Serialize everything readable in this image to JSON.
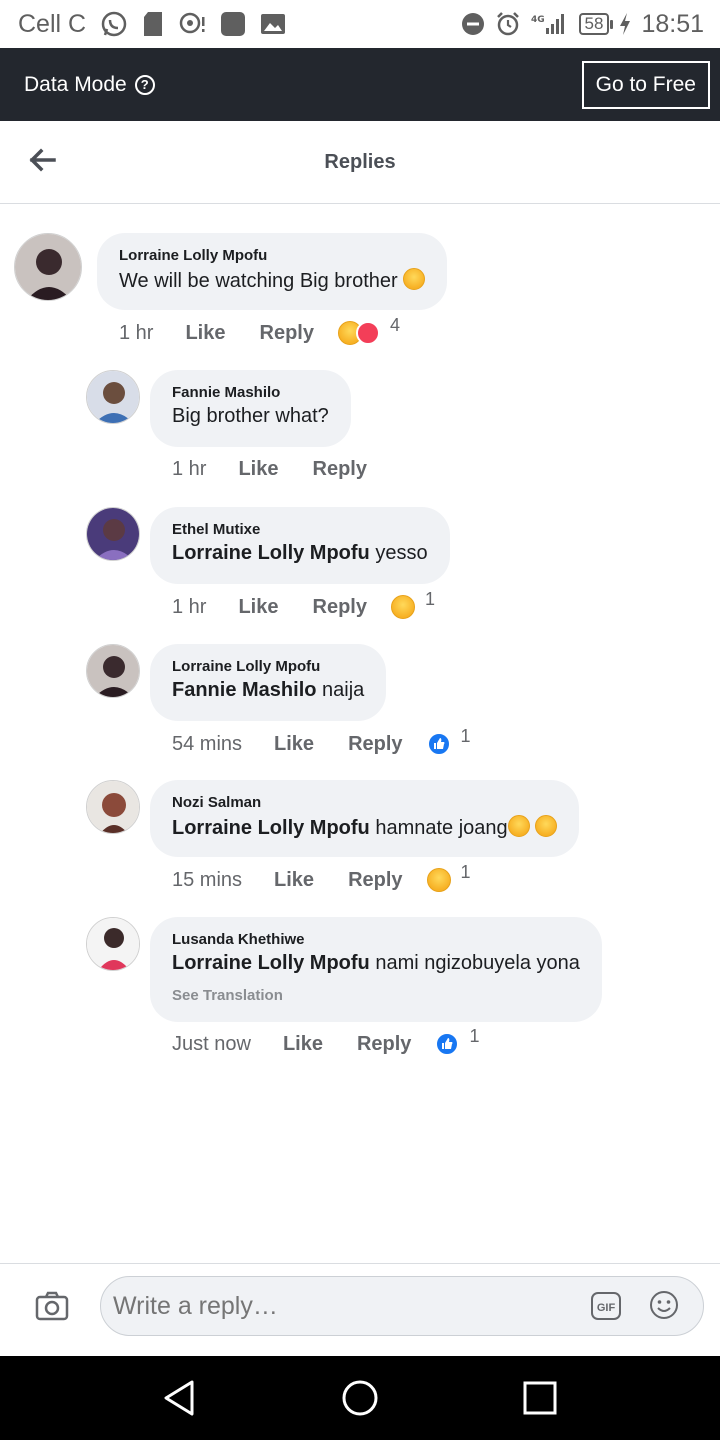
{
  "status_bar": {
    "carrier": "Cell C",
    "network": "4G",
    "battery": "58",
    "time": "18:51"
  },
  "data_bar": {
    "label": "Data Mode",
    "help_glyph": "?",
    "go_free_label": "Go to Free"
  },
  "header": {
    "title": "Replies"
  },
  "comments": [
    {
      "author": "Lorraine Lolly Mpofu",
      "mention": "",
      "text": "We will be watching Big brother",
      "time": "1 hr",
      "like_label": "Like",
      "reply_label": "Reply",
      "reactions": [
        "haha",
        "love"
      ],
      "reaction_count": "4",
      "avatar_color": "#3a2a2e"
    },
    {
      "author": "Fannie Mashilo",
      "mention": "",
      "text": "Big brother what?",
      "time": "1 hr",
      "like_label": "Like",
      "reply_label": "Reply",
      "reactions": [],
      "reaction_count": "",
      "avatar_color": "#3d6fb4"
    },
    {
      "author": "Ethel Mutixe",
      "mention": "Lorraine Lolly Mpofu",
      "text": " yesso",
      "time": "1 hr",
      "like_label": "Like",
      "reply_label": "Reply",
      "reactions": [
        "haha"
      ],
      "reaction_count": "1",
      "avatar_color": "#6a4c9c"
    },
    {
      "author": "Lorraine Lolly Mpofu",
      "mention": "Fannie Mashilo",
      "text": " naija",
      "time": "54 mins",
      "like_label": "Like",
      "reply_label": "Reply",
      "reactions": [
        "like"
      ],
      "reaction_count": "1",
      "avatar_color": "#3a2a2e"
    },
    {
      "author": "Nozi Salman",
      "mention": "Lorraine Lolly Mpofu",
      "text": " hamnate joang",
      "time": "15 mins",
      "like_label": "Like",
      "reply_label": "Reply",
      "reactions": [
        "haha"
      ],
      "reaction_count": "1",
      "avatar_color": "#8b4a3a"
    },
    {
      "author": "Lusanda Khethiwe",
      "mention": "Lorraine Lolly Mpofu",
      "text": " nami ngizobuyela yona",
      "see_translation": "See Translation",
      "time": "Just now",
      "like_label": "Like",
      "reply_label": "Reply",
      "reactions": [
        "like"
      ],
      "reaction_count": "1",
      "avatar_color": "#e0375b"
    }
  ],
  "reply_bar": {
    "placeholder": "Write a reply…",
    "gif_label": "GIF"
  },
  "colors": {
    "data_bar_bg": "#23272e",
    "bubble_bg": "#f0f2f5",
    "meta_text": "#65676b",
    "like_blue": "#1877f2",
    "love_red": "#f33e58",
    "haha_yellow": "#f7b125"
  }
}
